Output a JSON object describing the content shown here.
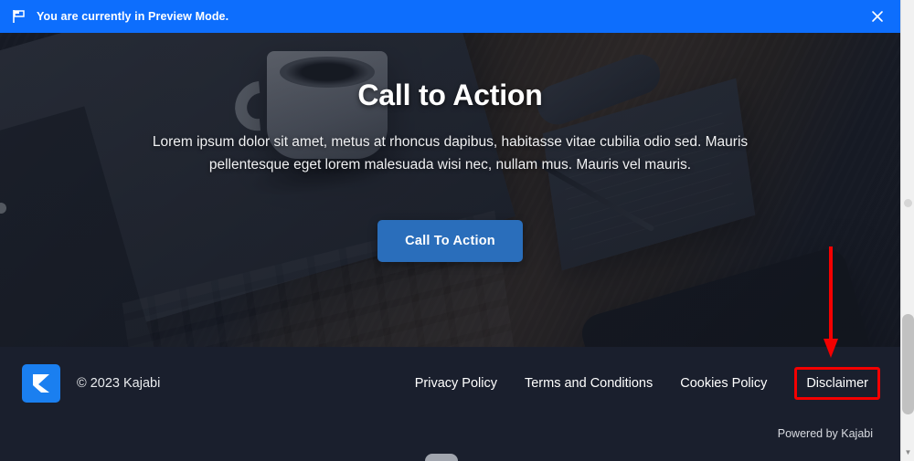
{
  "banner": {
    "message": "You are currently in Preview Mode.",
    "flag_icon": "flag-icon",
    "close_icon": "close-icon",
    "background_color": "#0d6efd"
  },
  "hero": {
    "title": "Call to Action",
    "subtitle": "Lorem ipsum dolor sit amet, metus at rhoncus dapibus, habitasse vitae cubilia odio sed. Mauris pellentesque eget lorem malesuada wisi nec, nullam mus. Mauris vel mauris.",
    "cta_label": "Call To Action",
    "cta_color": "#2a6ebb"
  },
  "footer": {
    "logo_alt": "kajabi-logo",
    "copyright": "© 2023 Kajabi",
    "links": [
      {
        "label": "Privacy Policy"
      },
      {
        "label": "Terms and Conditions"
      },
      {
        "label": "Cookies Policy"
      },
      {
        "label": "Disclaimer"
      }
    ],
    "powered_by": "Powered by Kajabi",
    "background_color": "#1a1f2d"
  },
  "annotation": {
    "arrow_color": "#f40000",
    "highlight_target": "Disclaimer",
    "highlight_color": "#f40000"
  },
  "scrollbar": {
    "thumb_color": "#c1c1c1",
    "track_color": "#f1f1f1"
  }
}
